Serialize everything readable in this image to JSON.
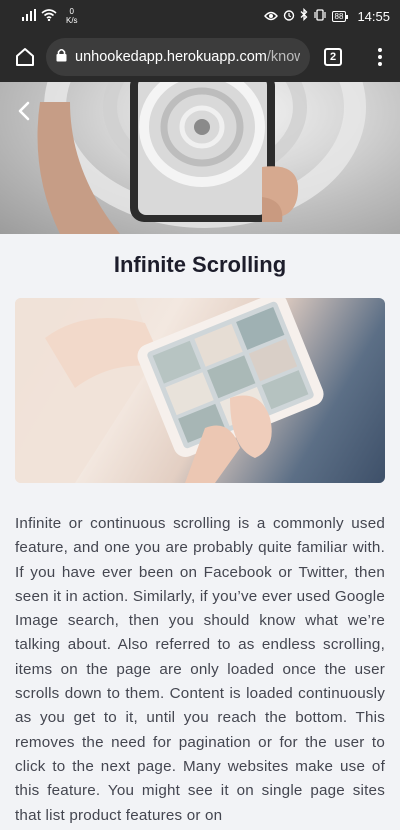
{
  "status_bar": {
    "netspeed_value": "0",
    "netspeed_unit": "K/s",
    "battery": "88",
    "time": "14:55"
  },
  "browser": {
    "url_host": "unhookedapp.herokuapp.com",
    "url_path": "/knowle",
    "tab_count": "2"
  },
  "article": {
    "title": "Infinite Scrolling",
    "body": "Infinite or continuous scrolling is a commonly used feature, and one you are probably quite familiar with. If you have ever been on Facebook or Twitter, then seen it in action. Similarly, if you’ve ever used Google Image search, then you should know what we’re talking about. Also referred to as endless scrolling, items on the page are only loaded once the user scrolls down to them. Content is loaded continuously as you get to it, until you reach the bottom. This removes the need for pagination or for the user to click to the next page. Many websites make use of this feature. You might see it on single page sites that list product features or on"
  }
}
